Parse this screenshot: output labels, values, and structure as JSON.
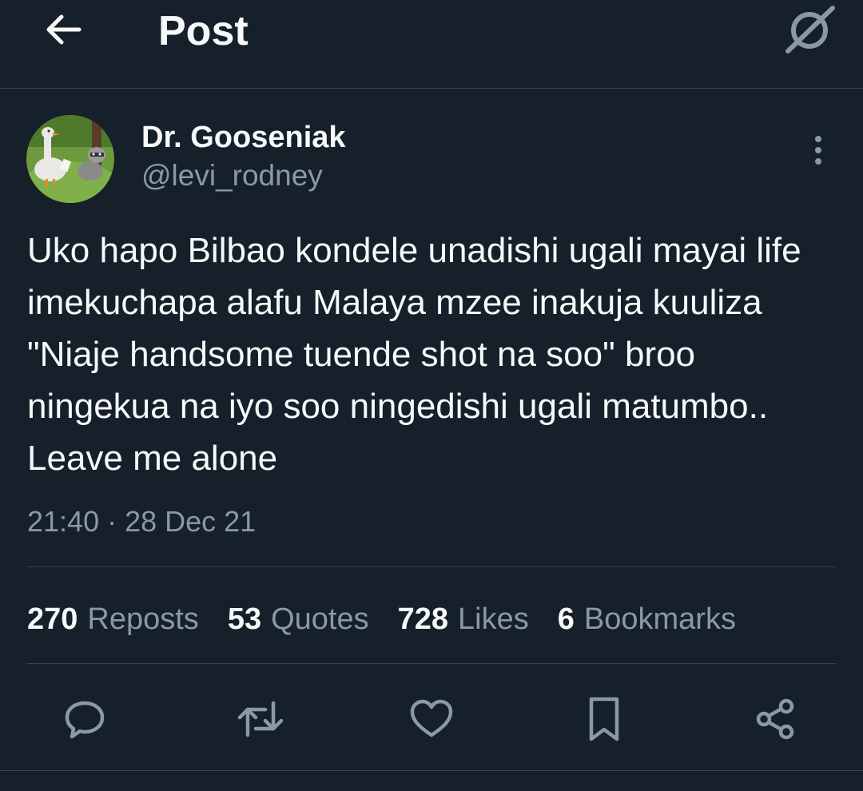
{
  "header": {
    "title": "Post",
    "back_icon": "arrow-left-icon",
    "grok_icon": "grok-icon"
  },
  "tweet": {
    "author": {
      "display_name": "Dr. Gooseniak",
      "handle": "@levi_rodney",
      "avatar": "goose-cartoon-avatar"
    },
    "text": "Uko hapo Bilbao kondele unadishi ugali mayai life imekuchapa alafu Malaya mzee inakuja kuuliza \"Niaje handsome tuende shot na soo\" broo ningekua na iyo soo ningedishi ugali matumbo.. Leave me alone",
    "timestamp": "21:40 · 28 Dec 21"
  },
  "stats": [
    {
      "count": "270",
      "label": "Reposts"
    },
    {
      "count": "53",
      "label": "Quotes"
    },
    {
      "count": "728",
      "label": "Likes"
    },
    {
      "count": "6",
      "label": "Bookmarks"
    }
  ],
  "actions": [
    {
      "name": "reply",
      "icon": "reply-icon"
    },
    {
      "name": "repost",
      "icon": "repost-icon"
    },
    {
      "name": "like",
      "icon": "heart-icon"
    },
    {
      "name": "bookmark",
      "icon": "bookmark-icon"
    },
    {
      "name": "share",
      "icon": "share-icon"
    }
  ],
  "colors": {
    "background": "#15202b",
    "primary_text": "#f7f9f9",
    "secondary_text": "#8b98a5",
    "divider": "#38444d"
  }
}
